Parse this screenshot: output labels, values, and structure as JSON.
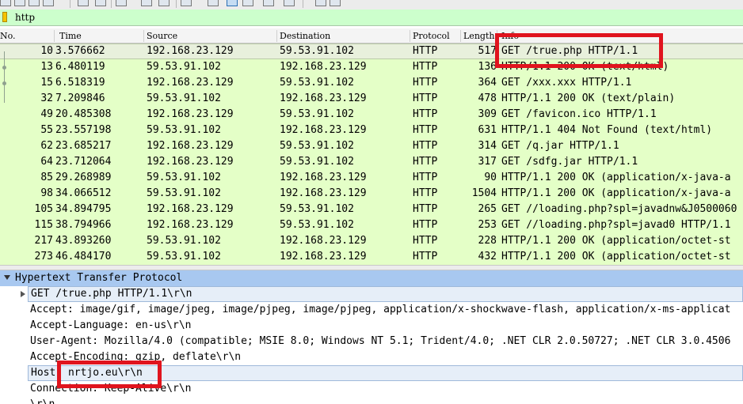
{
  "toolbar": {
    "icons": [
      "open-file-icon",
      "save-icon",
      "close-file-icon",
      "reload-icon",
      "print-icon",
      "find-icon",
      "go-back-icon",
      "go-forward-icon",
      "go-to-packet-icon",
      "first-packet-icon",
      "last-packet-icon",
      "colorize-icon",
      "auto-scroll-icon",
      "zoom-in-icon",
      "zoom-out-icon",
      "normal-size-icon",
      "resize-columns-icon"
    ]
  },
  "filter": {
    "value": "http"
  },
  "columns": {
    "no": "No.",
    "time": "Time",
    "source": "Source",
    "destination": "Destination",
    "protocol": "Protocol",
    "length": "Length",
    "info": "Info"
  },
  "packets": [
    {
      "no": "10",
      "time": "3.576662",
      "src": "192.168.23.129",
      "dst": "59.53.91.102",
      "proto": "HTTP",
      "len": "517",
      "info": "GET /true.php HTTP/1.1"
    },
    {
      "no": "13",
      "time": "6.480119",
      "src": "59.53.91.102",
      "dst": "192.168.23.129",
      "proto": "HTTP",
      "len": "136",
      "info": "HTTP/1.1 200 OK  (text/html)"
    },
    {
      "no": "15",
      "time": "6.518319",
      "src": "192.168.23.129",
      "dst": "59.53.91.102",
      "proto": "HTTP",
      "len": "364",
      "info": "GET /xxx.xxx HTTP/1.1"
    },
    {
      "no": "32",
      "time": "7.209846",
      "src": "59.53.91.102",
      "dst": "192.168.23.129",
      "proto": "HTTP",
      "len": "478",
      "info": "HTTP/1.1 200 OK  (text/plain)"
    },
    {
      "no": "49",
      "time": "20.485308",
      "src": "192.168.23.129",
      "dst": "59.53.91.102",
      "proto": "HTTP",
      "len": "309",
      "info": "GET /favicon.ico HTTP/1.1"
    },
    {
      "no": "55",
      "time": "23.557198",
      "src": "59.53.91.102",
      "dst": "192.168.23.129",
      "proto": "HTTP",
      "len": "631",
      "info": "HTTP/1.1 404 Not Found  (text/html)"
    },
    {
      "no": "62",
      "time": "23.685217",
      "src": "192.168.23.129",
      "dst": "59.53.91.102",
      "proto": "HTTP",
      "len": "314",
      "info": "GET /q.jar HTTP/1.1"
    },
    {
      "no": "64",
      "time": "23.712064",
      "src": "192.168.23.129",
      "dst": "59.53.91.102",
      "proto": "HTTP",
      "len": "317",
      "info": "GET /sdfg.jar HTTP/1.1"
    },
    {
      "no": "85",
      "time": "29.268989",
      "src": "59.53.91.102",
      "dst": "192.168.23.129",
      "proto": "HTTP",
      "len": "90",
      "info": "HTTP/1.1 200 OK  (application/x-java-a"
    },
    {
      "no": "98",
      "time": "34.066512",
      "src": "59.53.91.102",
      "dst": "192.168.23.129",
      "proto": "HTTP",
      "len": "1504",
      "info": "HTTP/1.1 200 OK  (application/x-java-a"
    },
    {
      "no": "105",
      "time": "34.894795",
      "src": "192.168.23.129",
      "dst": "59.53.91.102",
      "proto": "HTTP",
      "len": "265",
      "info": "GET //loading.php?spl=javadnw&J0500060"
    },
    {
      "no": "115",
      "time": "38.794966",
      "src": "192.168.23.129",
      "dst": "59.53.91.102",
      "proto": "HTTP",
      "len": "253",
      "info": "GET //loading.php?spl=javad0 HTTP/1.1"
    },
    {
      "no": "217",
      "time": "43.893260",
      "src": "59.53.91.102",
      "dst": "192.168.23.129",
      "proto": "HTTP",
      "len": "228",
      "info": "HTTP/1.1 200 OK  (application/octet-st"
    },
    {
      "no": "273",
      "time": "46.484170",
      "src": "59.53.91.102",
      "dst": "192.168.23.129",
      "proto": "HTTP",
      "len": "432",
      "info": "HTTP/1.1 200 OK  (application/octet-st"
    }
  ],
  "detail": {
    "protocol": "Hypertext Transfer Protocol",
    "request_line": "GET /true.php HTTP/1.1\\r\\n",
    "accept": "Accept: image/gif, image/jpeg, image/pjpeg, image/pjpeg, application/x-shockwave-flash, application/x-ms-applicat",
    "accept_language": "Accept-Language: en-us\\r\\n",
    "user_agent": "User-Agent: Mozilla/4.0 (compatible; MSIE 8.0; Windows NT 5.1; Trident/4.0; .NET CLR 2.0.50727; .NET CLR 3.0.4506",
    "accept_encoding": "Accept-Encoding: gzip, deflate\\r\\n",
    "host": "Host: nrtjo.eu\\r\\n",
    "connection": "Connection: Keep-Alive\\r\\n",
    "blank": "\\r\\n"
  },
  "colors": {
    "http_row": "#e4ffc7",
    "filter_bg": "#ccffcc",
    "protocol_header": "#a8c8f0",
    "annotation": "#e0141e"
  }
}
